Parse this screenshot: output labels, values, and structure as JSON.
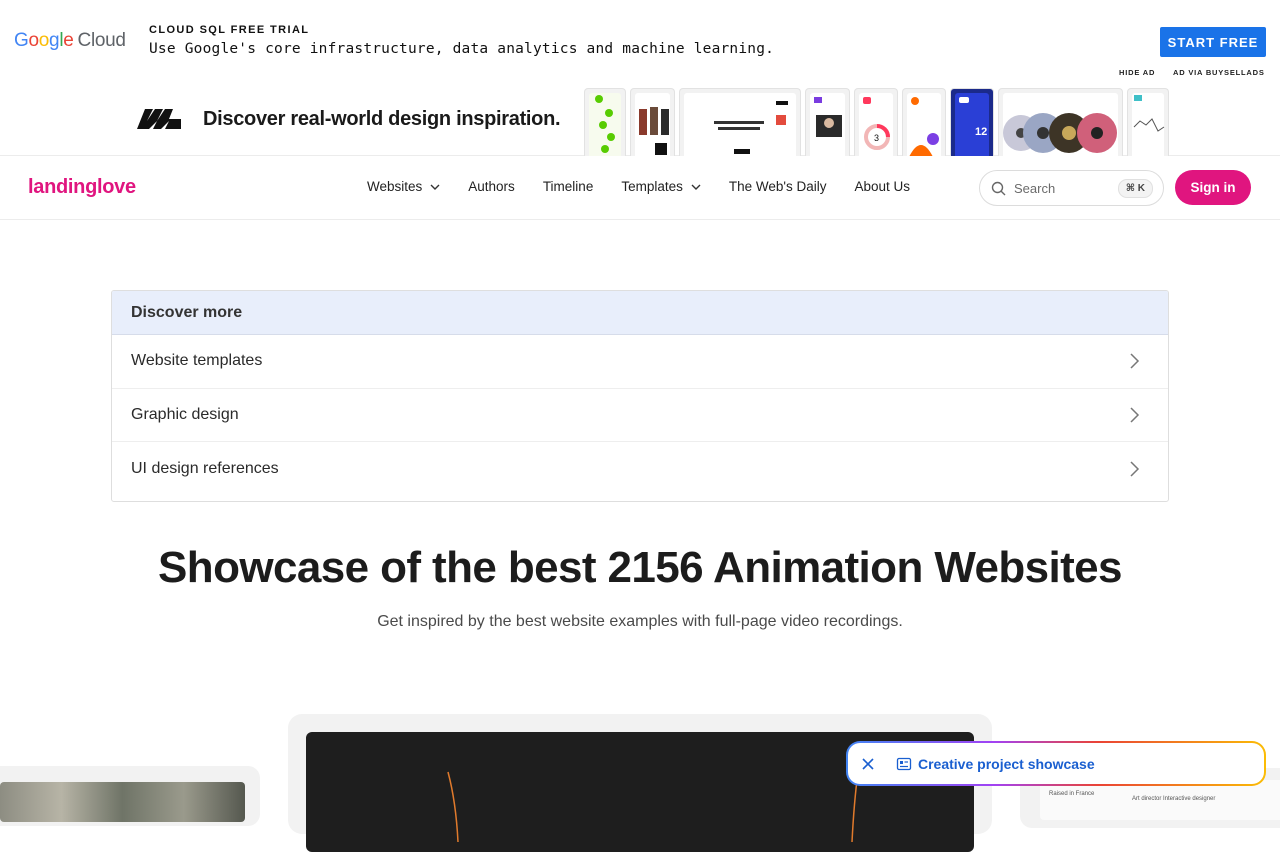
{
  "ad": {
    "logo_google": [
      "G",
      "o",
      "o",
      "g",
      "l",
      "e"
    ],
    "logo_cloud": "Cloud",
    "kicker": "CLOUD SQL FREE TRIAL",
    "text": "Use Google's core infrastructure, data analytics and machine learning.",
    "cta": "START FREE",
    "hide_ad": "HIDE AD",
    "ad_via": "AD VIA BUYSELLADS"
  },
  "inspiration": {
    "text": "Discover real-world design inspiration.",
    "thumb_badge": "12",
    "thumb_badge_2": "3"
  },
  "nav": {
    "brand": "landinglove",
    "links": [
      {
        "label": "Websites",
        "has_dropdown": true
      },
      {
        "label": "Authors",
        "has_dropdown": false
      },
      {
        "label": "Timeline",
        "has_dropdown": false
      },
      {
        "label": "Templates",
        "has_dropdown": true
      },
      {
        "label": "The Web's Daily",
        "has_dropdown": false
      },
      {
        "label": "About Us",
        "has_dropdown": false
      }
    ],
    "search_placeholder": "Search",
    "search_shortcut": "⌘ K",
    "sign_in": "Sign in"
  },
  "discover": {
    "heading": "Discover more",
    "items": [
      {
        "label": "Website templates"
      },
      {
        "label": "Graphic design"
      },
      {
        "label": "UI design references"
      }
    ]
  },
  "hero": {
    "title": "Showcase of the best 2156 Animation Websites",
    "subtitle": "Get inspired by the best website examples with full-page video recordings."
  },
  "cards": {
    "right_text_1": "Raised in France",
    "right_text_2": "Art director Interactive designer"
  },
  "pill": {
    "label": "Creative project showcase"
  },
  "colors": {
    "brand_pink": "#e0157f",
    "ad_blue": "#1a73e8",
    "discover_head_bg": "#e8eefb",
    "pill_text": "#1a5fd0"
  }
}
